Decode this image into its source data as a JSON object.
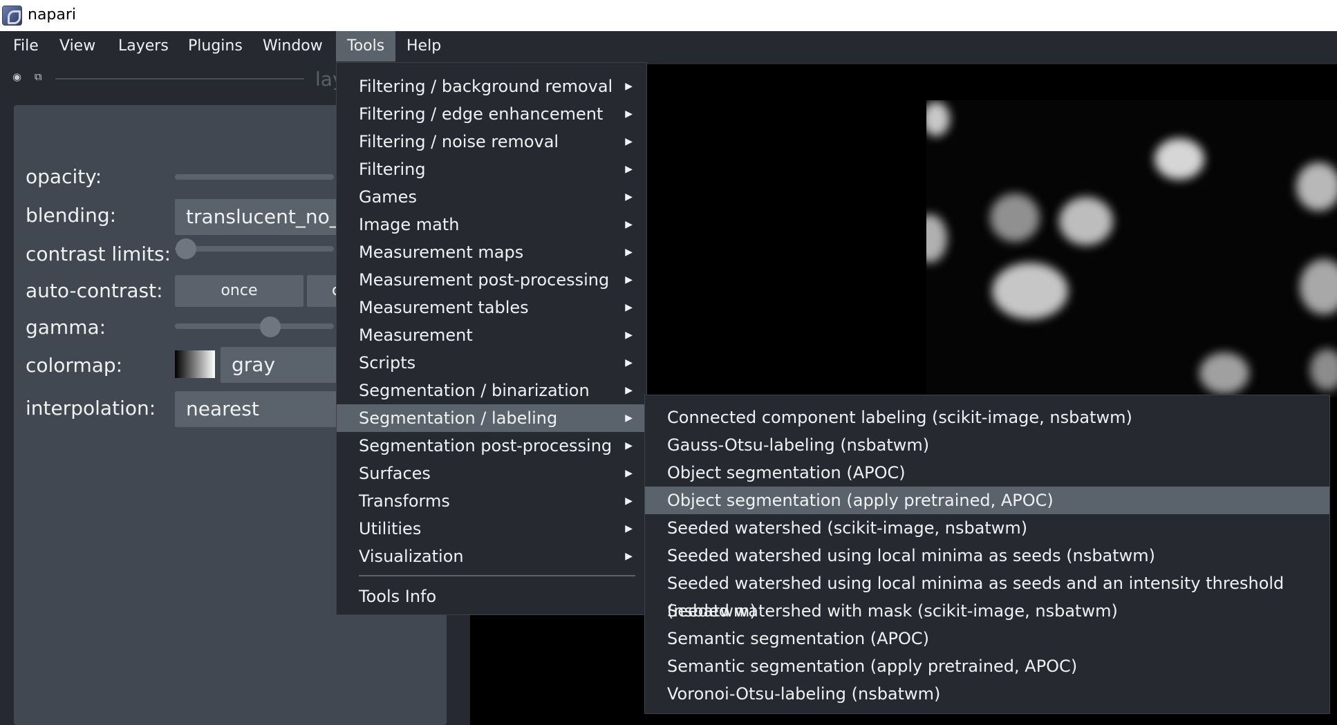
{
  "window": {
    "title": "napari"
  },
  "menubar": {
    "items": [
      "File",
      "View",
      "Layers",
      "Plugins",
      "Window",
      "Tools",
      "Help"
    ],
    "active": "Tools"
  },
  "layer_list": {
    "title_fragment": "lay"
  },
  "layer_controls": {
    "opacity_label": "opacity:",
    "blending_label": "blending:",
    "blending_value": "translucent_no_(",
    "contrast_label": "contrast limits:",
    "autocontrast_label": "auto-contrast:",
    "autocontrast_once": "once",
    "autocontrast_continuous_fragment": "c",
    "gamma_label": "gamma:",
    "colormap_label": "colormap:",
    "colormap_value": "gray",
    "interpolation_label": "interpolation:",
    "interpolation_value": "nearest"
  },
  "tools_menu": {
    "items": [
      {
        "label": "Filtering / background removal",
        "submenu": true
      },
      {
        "label": "Filtering / edge enhancement",
        "submenu": true
      },
      {
        "label": "Filtering / noise removal",
        "submenu": true
      },
      {
        "label": "Filtering",
        "submenu": true
      },
      {
        "label": "Games",
        "submenu": true
      },
      {
        "label": "Image math",
        "submenu": true
      },
      {
        "label": "Measurement maps",
        "submenu": true
      },
      {
        "label": "Measurement post-processing",
        "submenu": true
      },
      {
        "label": "Measurement tables",
        "submenu": true
      },
      {
        "label": "Measurement",
        "submenu": true
      },
      {
        "label": "Scripts",
        "submenu": true
      },
      {
        "label": "Segmentation / binarization",
        "submenu": true
      },
      {
        "label": "Segmentation / labeling",
        "submenu": true
      },
      {
        "label": "Segmentation post-processing",
        "submenu": true
      },
      {
        "label": "Surfaces",
        "submenu": true
      },
      {
        "label": "Transforms",
        "submenu": true
      },
      {
        "label": "Utilities",
        "submenu": true
      },
      {
        "label": "Visualization",
        "submenu": true
      }
    ],
    "highlighted": "Segmentation / labeling",
    "footer_item": "Tools Info"
  },
  "labeling_submenu": {
    "items": [
      "Connected component labeling (scikit-image, nsbatwm)",
      "Gauss-Otsu-labeling (nsbatwm)",
      "Object segmentation (APOC)",
      "Object segmentation (apply pretrained, APOC)",
      "Seeded watershed (scikit-image, nsbatwm)",
      "Seeded watershed using local minima as seeds (nsbatwm)",
      "Seeded watershed using local minima as seeds and an intensity threshold (nsbatwm)",
      "Seeded watershed with mask (scikit-image, nsbatwm)",
      "Semantic segmentation (APOC)",
      "Semantic segmentation (apply pretrained, APOC)",
      "Voronoi-Otsu-labeling (nsbatwm)"
    ],
    "highlighted": "Object segmentation (apply pretrained, APOC)"
  },
  "icons": {
    "visibility": "eye-icon",
    "duplicate": "duplicate-icon",
    "submenu_arrow": "triangle-right-icon"
  },
  "colors": {
    "background": "#262930",
    "panel": "#414851",
    "highlight": "#5a626c",
    "text": "#f0f1f2"
  }
}
